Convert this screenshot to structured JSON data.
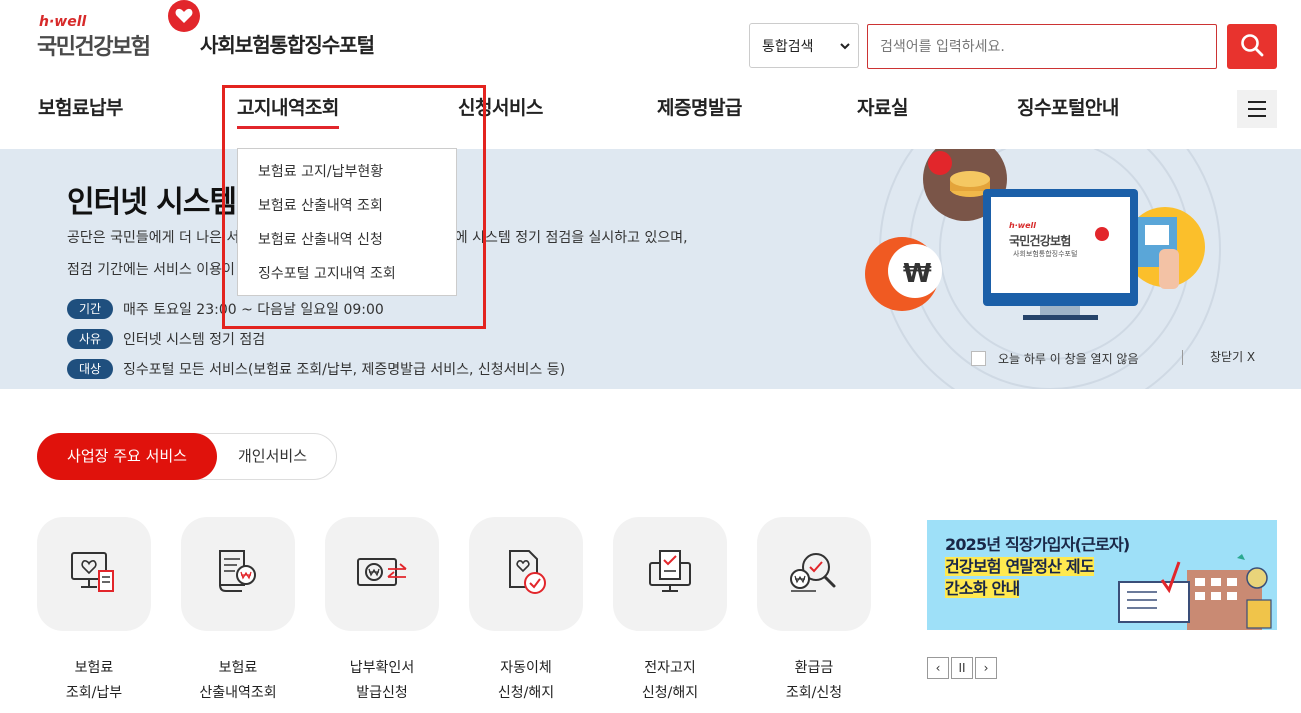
{
  "header": {
    "logo_tagline": "h·well",
    "logo_brand": "국민건강보험",
    "portal_title": "사회보험통합징수포털",
    "search_select": "통합검색",
    "search_placeholder": "검색어를 입력하세요."
  },
  "nav": {
    "items": [
      "보험료납부",
      "고지내역조회",
      "신청서비스",
      "제증명발급",
      "자료실",
      "징수포털안내"
    ],
    "active": "고지내역조회"
  },
  "dropdown": {
    "items": [
      "보험료 고지/납부현황",
      "보험료 산출내역 조회",
      "보험료 산출내역 신청",
      "징수포털 고지내역 조회"
    ]
  },
  "banner": {
    "title": "인터넷 시스템 정기 점검 안내",
    "desc_line1": "공단은 국민들에게 더 나은 서비스를 제공하기 위해 매주 아래 기간에 시스템 정기 점검을 실시하고 있으며,",
    "desc_line2": "점검 기간에는 서비스 이용이 제한되오니 양해 바랍니다.",
    "rows": [
      {
        "tag": "기간",
        "text": "매주 토요일 23:00 ~ 다음날 일요일 09:00"
      },
      {
        "tag": "사유",
        "text": "인터넷 시스템 정기 점검"
      },
      {
        "tag": "대상",
        "text": "징수포털 모든 서비스(보험료 조회/납부, 제증명발급 서비스, 신청서비스 등)"
      }
    ],
    "dont_show": "오늘 하루 이 창을 열지 않음",
    "close": "창닫기 X",
    "monitor_brand": "국민건강보험",
    "monitor_sub": "사회보험통합징수포털",
    "monitor_tagline": "h·well",
    "won_symbol": "₩"
  },
  "tabs": {
    "active": "사업장 주요 서비스",
    "inactive": "개인서비스"
  },
  "services": [
    {
      "line1": "보험료",
      "line2": "조회/납부",
      "icon": "monitor-heart-icon"
    },
    {
      "line1": "보험료",
      "line2": "산출내역조회",
      "icon": "document-won-icon"
    },
    {
      "line1": "납부확인서",
      "line2": "발급신청",
      "icon": "wallet-won-icon"
    },
    {
      "line1": "자동이체",
      "line2": "신청/해지",
      "icon": "document-check-icon"
    },
    {
      "line1": "전자고지",
      "line2": "신청/해지",
      "icon": "kiosk-check-icon"
    },
    {
      "line1": "환급금",
      "line2": "조회/신청",
      "icon": "search-won-icon"
    }
  ],
  "promo": {
    "line1": "2025년 직장가입자(근로자)",
    "line2": "건강보험 연말정산 제도",
    "line3": "간소화 안내"
  },
  "slider": {
    "prev": "‹",
    "pause": "II",
    "next": "›"
  },
  "colors": {
    "accent": "#e2262b",
    "tag_bg": "#1f4f7e",
    "banner_bg": "#dfe8f1",
    "promo_bg": "#9ee0f8"
  }
}
